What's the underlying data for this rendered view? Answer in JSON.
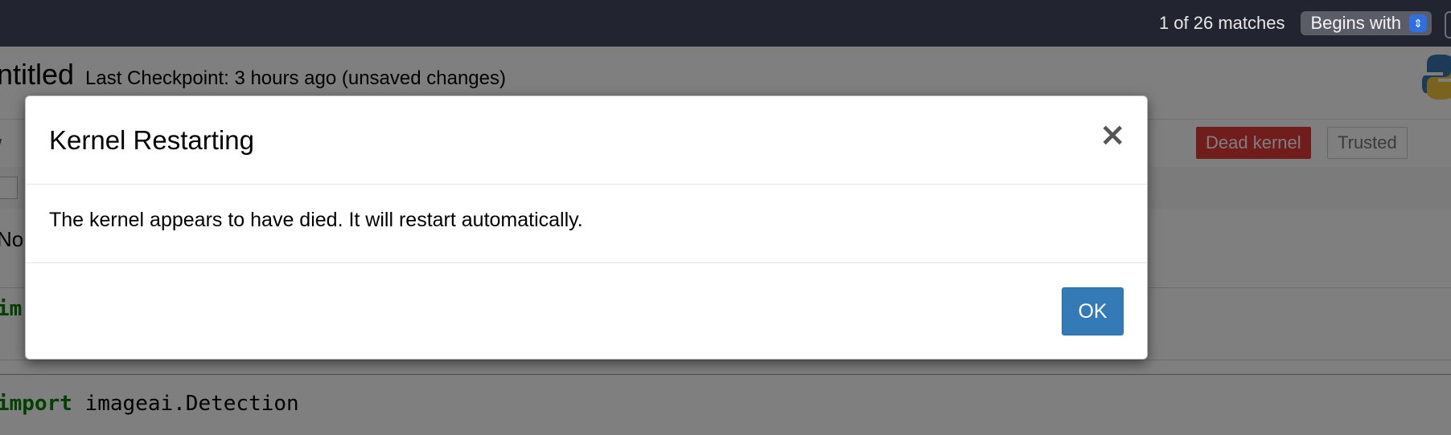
{
  "findbar": {
    "match_count": "1 of 26 matches",
    "mode_select": "Begins with"
  },
  "notebook": {
    "title": "ntitled",
    "checkpoint": "Last Checkpoint: 3 hours ago   (unsaved changes)",
    "toolbar_fragment": "/",
    "kernel_status": "Dead kernel",
    "trust_status": "Trusted",
    "cell_fragment_1": "No",
    "code_fragment_1": "im",
    "code_line_2": {
      "keyword": "import",
      "rest": " imageai.Detection"
    }
  },
  "modal": {
    "title": "Kernel Restarting",
    "close_symbol": "×",
    "message": "The kernel appears to have died. It will restart automatically.",
    "ok_label": "OK"
  },
  "colors": {
    "ok_button": "#337ab7",
    "dead_kernel_badge": "#e03a36",
    "findbar_bg": "#22252f"
  }
}
